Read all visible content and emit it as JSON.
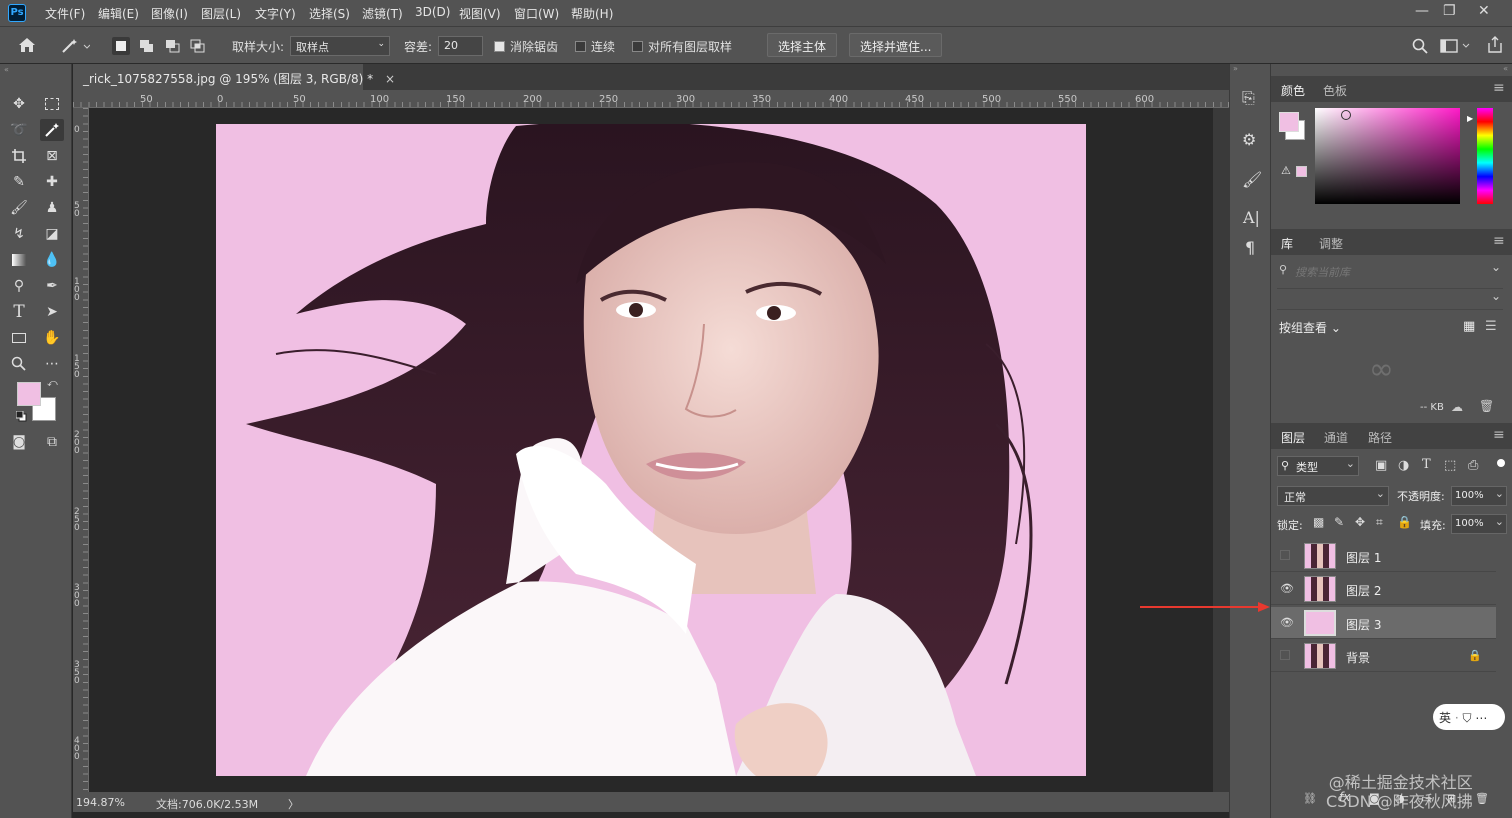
{
  "menubar": {
    "logo": "Ps",
    "items": [
      "文件(F)",
      "编辑(E)",
      "图像(I)",
      "图层(L)",
      "文字(Y)",
      "选择(S)",
      "滤镜(T)",
      "3D(D)",
      "视图(V)",
      "窗口(W)",
      "帮助(H)"
    ]
  },
  "options": {
    "sample_size_label": "取样大小:",
    "sample_size_value": "取样点",
    "tolerance_label": "容差:",
    "tolerance_value": "20",
    "antialias_label": "消除锯齿",
    "antialias_checked": true,
    "contiguous_label": "连续",
    "contiguous_checked": false,
    "all_layers_label": "对所有图层取样",
    "all_layers_checked": false,
    "select_subject": "选择主体",
    "select_mask": "选择并遮住..."
  },
  "document": {
    "tab_title": "_rick_1075827558.jpg @ 195% (图层 3, RGB/8) *",
    "close": "×",
    "ruler_h": [
      "50",
      "0",
      "50",
      "100",
      "150",
      "200",
      "250",
      "300",
      "350",
      "400",
      "450",
      "500",
      "550",
      "600"
    ],
    "ruler_v": [
      "0",
      "5 0",
      "1 0 0",
      "1 5 0",
      "2 0 0",
      "2 5 0",
      "3 0 0",
      "3 5 0",
      "4 0 0"
    ],
    "canvas_bg": "#f0bfe3"
  },
  "status": {
    "zoom": "194.87%",
    "doc": "文档:706.0K/2.53M",
    "arrow": "〉"
  },
  "colors": {
    "foreground": "#f0bfe3",
    "background": "#ffffff"
  },
  "color_panel": {
    "tab1": "颜色",
    "tab2": "色板"
  },
  "library_panel": {
    "tab1": "库",
    "tab2": "调整",
    "search_placeholder": "搜索当前库",
    "group_label": "按组查看",
    "size": "-- KB"
  },
  "layers_panel": {
    "tabs": [
      "图层",
      "通道",
      "路径"
    ],
    "filter_label": "类型",
    "blend_mode": "正常",
    "opacity_label": "不透明度:",
    "opacity_value": "100%",
    "lock_label": "锁定:",
    "fill_label": "填充:",
    "fill_value": "100%",
    "layers": [
      {
        "name": "图层 1",
        "visible": false,
        "selected": false,
        "thumb": "photo"
      },
      {
        "name": "图层 2",
        "visible": true,
        "selected": false,
        "thumb": "photo"
      },
      {
        "name": "图层 3",
        "visible": true,
        "selected": true,
        "thumb": "pink"
      },
      {
        "name": "背景",
        "visible": false,
        "selected": false,
        "thumb": "photo",
        "locked": true
      }
    ]
  },
  "ime": {
    "label": "英"
  },
  "watermark": "@稀土掘金技术社区\nCSDN @昨夜秋风拂"
}
